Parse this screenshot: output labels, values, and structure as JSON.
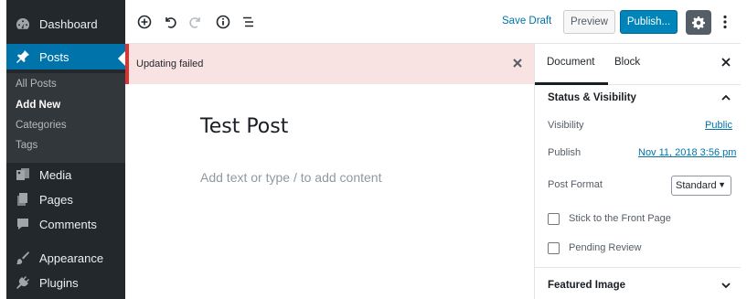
{
  "sidebar": {
    "items": [
      {
        "label": "Dashboard",
        "icon": "dashboard-icon"
      },
      {
        "label": "Posts",
        "icon": "pushpin-icon"
      },
      {
        "label": "Media",
        "icon": "media-icon"
      },
      {
        "label": "Pages",
        "icon": "pages-icon"
      },
      {
        "label": "Comments",
        "icon": "comments-icon"
      },
      {
        "label": "Appearance",
        "icon": "appearance-icon"
      },
      {
        "label": "Plugins",
        "icon": "plugins-icon"
      }
    ],
    "submenu": [
      "All Posts",
      "Add New",
      "Categories",
      "Tags"
    ]
  },
  "toolbar": {
    "save_draft": "Save Draft",
    "preview": "Preview",
    "publish": "Publish..."
  },
  "notice": {
    "text": "Updating failed"
  },
  "editor": {
    "title": "Test Post",
    "body_placeholder": "Add text or type / to add content"
  },
  "settings": {
    "tabs": [
      "Document",
      "Block"
    ],
    "status_panel": {
      "title": "Status & Visibility",
      "visibility_label": "Visibility",
      "visibility_value": "Public",
      "publish_label": "Publish",
      "publish_value": "Nov 11, 2018 3:56 pm",
      "format_label": "Post Format",
      "format_value": "Standard",
      "sticky_label": "Stick to the Front Page",
      "pending_label": "Pending Review"
    },
    "featured_image_title": "Featured Image"
  },
  "colors": {
    "sidebar_bg": "#23282d",
    "accent": "#0073aa",
    "publish_bg": "#0085ba",
    "notice_border": "#dc3232",
    "notice_bg": "#f9e2e2"
  }
}
